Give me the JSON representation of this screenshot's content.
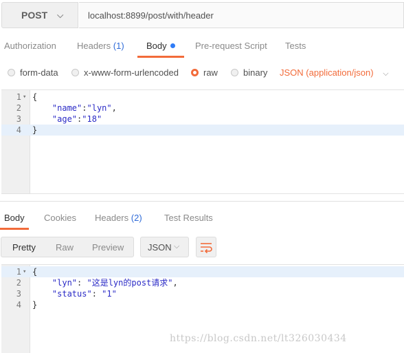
{
  "request": {
    "method": "POST",
    "url": "localhost:8899/post/with/header"
  },
  "request_tabs": {
    "authorization": "Authorization",
    "headers": "Headers",
    "headers_count": "(1)",
    "body": "Body",
    "prerequest": "Pre-request Script",
    "tests": "Tests"
  },
  "body_type": {
    "form_data": "form-data",
    "urlencoded": "x-www-form-urlencoded",
    "raw": "raw",
    "binary": "binary",
    "selected": "raw",
    "content_type": "JSON (application/json)"
  },
  "request_body": {
    "line_numbers": [
      "1",
      "2",
      "3",
      "4"
    ],
    "lines": [
      {
        "pre": "{",
        "key": "",
        "sep": "",
        "val": "",
        "post": ""
      },
      {
        "pre": "    ",
        "key": "\"name\"",
        "sep": ":",
        "val": "\"lyn\"",
        "post": ","
      },
      {
        "pre": "    ",
        "key": "\"age\"",
        "sep": ":",
        "val": "\"18\"",
        "post": ""
      },
      {
        "pre": "}",
        "key": "",
        "sep": "",
        "val": "",
        "post": ""
      }
    ]
  },
  "response_tabs": {
    "body": "Body",
    "cookies": "Cookies",
    "headers": "Headers",
    "headers_count": "(2)",
    "test_results": "Test Results"
  },
  "response_toolbar": {
    "pretty": "Pretty",
    "raw": "Raw",
    "preview": "Preview",
    "format": "JSON"
  },
  "response_body": {
    "line_numbers": [
      "1",
      "2",
      "3",
      "4"
    ],
    "lines": [
      {
        "pre": "{",
        "key": "",
        "sep": "",
        "val": "",
        "post": ""
      },
      {
        "pre": "    ",
        "key": "\"lyn\"",
        "sep": ": ",
        "val": "\"这是lyn的post请求\"",
        "post": ","
      },
      {
        "pre": "    ",
        "key": "\"status\"",
        "sep": ": ",
        "val": "\"1\"",
        "post": ""
      },
      {
        "pre": "}",
        "key": "",
        "sep": "",
        "val": "",
        "post": ""
      }
    ]
  },
  "watermark": "https://blog.csdn.net/lt326030434",
  "colors": {
    "accent": "#f26b3a",
    "count_blue": "#2f6bd8",
    "dot_blue": "#2f7cf6",
    "string_blue": "#2a2ac6"
  },
  "icons": {
    "method_dropdown": "chevron-down-icon",
    "content_type_dropdown": "chevron-down-icon",
    "format_dropdown": "chevron-down-icon",
    "wrap_lines": "wrap-lines-icon",
    "fold": "fold-triangle-icon"
  }
}
